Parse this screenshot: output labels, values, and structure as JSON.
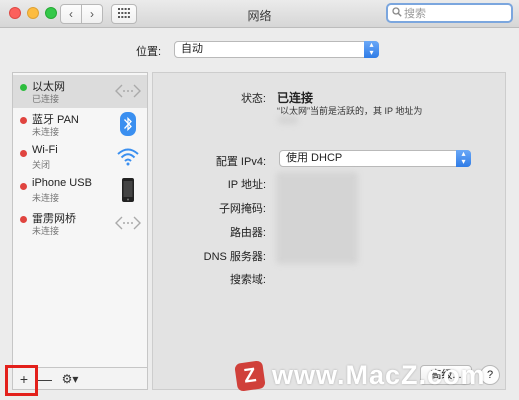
{
  "window": {
    "title": "网络",
    "search_placeholder": "搜索"
  },
  "location": {
    "label": "位置:",
    "value": "自动"
  },
  "services": [
    {
      "name": "以太网",
      "status": "已连接",
      "dot": "green",
      "icon": "ethernet-icon",
      "selected": true
    },
    {
      "name": "蓝牙 PAN",
      "status": "未连接",
      "dot": "red",
      "icon": "bluetooth-icon",
      "selected": false
    },
    {
      "name": "Wi-Fi",
      "status": "关闭",
      "dot": "red",
      "icon": "wifi-icon",
      "selected": false
    },
    {
      "name": "iPhone USB",
      "status": "未连接",
      "dot": "red",
      "icon": "iphone-icon",
      "selected": false
    },
    {
      "name": "雷雳网桥",
      "status": "未连接",
      "dot": "red",
      "icon": "thunderbolt-bridge-icon",
      "selected": false
    }
  ],
  "toolbar": {
    "add": "+",
    "remove": "—",
    "gear": "⚙▾"
  },
  "detail": {
    "status_label": "状态:",
    "status_value": "已连接",
    "status_desc": "“以太网”当前是活跃的，其 IP 地址为",
    "configure_label": "配置 IPv4:",
    "configure_value": "使用 DHCP",
    "ip_label": "IP 地址:",
    "subnet_label": "子网掩码:",
    "router_label": "路由器:",
    "dns_label": "DNS 服务器:",
    "search_domain_label": "搜索域:",
    "advanced_button": "高级...",
    "help_button": "?"
  },
  "watermark": {
    "logo": "Z",
    "text": "www.MacZ.com"
  },
  "colors": {
    "connected": "#2dbd3e",
    "disconnected": "#e0443f",
    "highlight": "#e3201b",
    "accent": "#2f7ce7"
  }
}
